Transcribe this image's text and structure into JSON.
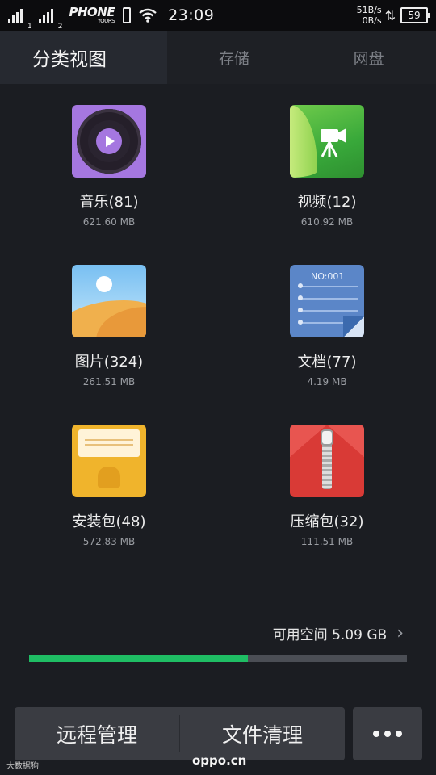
{
  "status_bar": {
    "sim1": "1",
    "sim2": "2",
    "carrier": "PHONE",
    "carrier_sub": "YOURS",
    "time": "23:09",
    "speed_up": "51B/s",
    "speed_down": "0B/s",
    "battery": "59"
  },
  "tabs": [
    {
      "label": "分类视图",
      "active": true
    },
    {
      "label": "存储",
      "active": false
    },
    {
      "label": "网盘",
      "active": false
    }
  ],
  "categories": [
    {
      "name": "音乐(81)",
      "size": "621.60 MB",
      "icon": "music-icon",
      "color": "#a577e0"
    },
    {
      "name": "视频(12)",
      "size": "610.92 MB",
      "icon": "video-icon",
      "color": "#38a83a"
    },
    {
      "name": "图片(324)",
      "size": "261.51 MB",
      "icon": "picture-icon",
      "color": "#78bff2"
    },
    {
      "name": "文档(77)",
      "size": "4.19 MB",
      "icon": "document-icon",
      "color": "#5b86c8",
      "icon_text": "NO:001"
    },
    {
      "name": "安装包(48)",
      "size": "572.83 MB",
      "icon": "package-icon",
      "color": "#f0b42c"
    },
    {
      "name": "压缩包(32)",
      "size": "111.51 MB",
      "icon": "zip-icon",
      "color": "#d93a36"
    }
  ],
  "storage": {
    "label": "可用空间 5.09 GB",
    "used_fraction": 0.58,
    "bar_color": "#1fbd64"
  },
  "bottom_bar": {
    "remote_label": "远程管理",
    "clean_label": "文件清理",
    "more_icon": "more-icon"
  },
  "watermark": "oppo.cn",
  "watermark_left": "大数据狗"
}
